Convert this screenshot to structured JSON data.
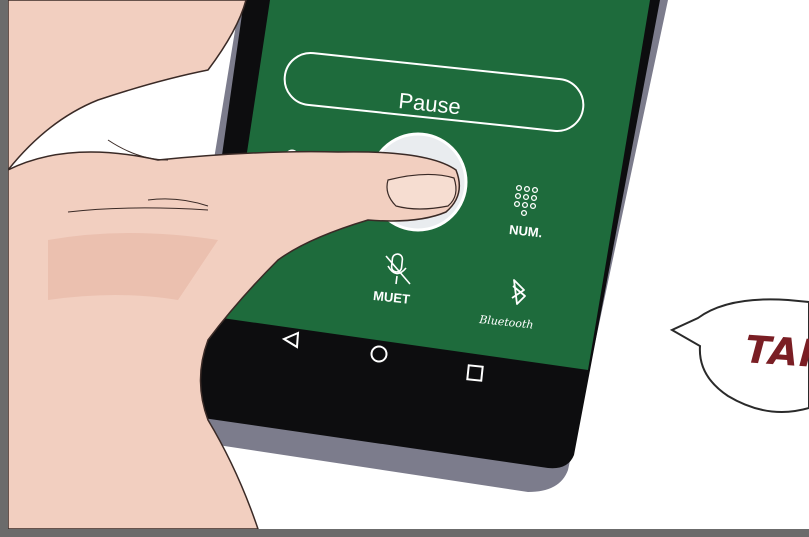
{
  "screen": {
    "pause_label": "Pause",
    "keypad_label": "NUM.",
    "mute_label": "MUET",
    "bluetooth_label": "Bluetooth"
  },
  "speech_bubble": {
    "text": "TAP"
  },
  "colors": {
    "screen_green": "#1e6b3c",
    "phone_frame": "#0d0d0f",
    "phone_edge": "#7c7c8c",
    "skin": "#f2cfc0",
    "sfx_red": "#7a1e24"
  },
  "icons": [
    "voicemail-icon",
    "call-button-icon",
    "keypad-icon",
    "mute-icon",
    "bluetooth-icon",
    "back-icon",
    "home-icon",
    "recents-icon"
  ]
}
